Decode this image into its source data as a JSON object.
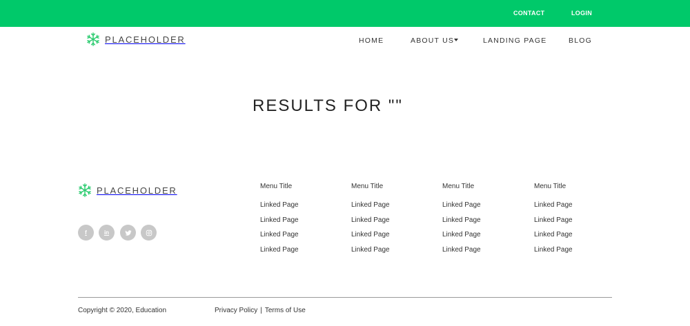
{
  "topbar": {
    "contact_label": "CONTACT",
    "login_label": "LOGIN",
    "background_color": "#00c96a"
  },
  "brand": {
    "name": "PLACEHOLDER",
    "logo_icon": "snowflake-logo-icon",
    "logo_color": "#2ecc71"
  },
  "nav": {
    "items": [
      {
        "label": "HOME"
      },
      {
        "label": "ABOUT US",
        "has_dropdown": true
      },
      {
        "label": "LANDING PAGE"
      },
      {
        "label": "BLOG"
      }
    ]
  },
  "main": {
    "results_heading": "RESULTS FOR \"\""
  },
  "footer": {
    "social": [
      {
        "icon": "facebook-icon",
        "glyph": "f"
      },
      {
        "icon": "linkedin-icon",
        "glyph": "in"
      },
      {
        "icon": "twitter-icon"
      },
      {
        "icon": "instagram-icon"
      }
    ],
    "columns": [
      {
        "title": "Menu Title",
        "links": [
          "Linked Page",
          "Linked Page",
          "Linked Page",
          "Linked Page"
        ]
      },
      {
        "title": "Menu Title",
        "links": [
          "Linked Page",
          "Linked Page",
          "Linked Page",
          "Linked Page"
        ]
      },
      {
        "title": "Menu Title",
        "links": [
          "Linked Page",
          "Linked Page",
          "Linked Page",
          "Linked Page"
        ]
      },
      {
        "title": "Menu Title",
        "links": [
          "Linked Page",
          "Linked Page",
          "Linked Page",
          "Linked Page"
        ]
      }
    ],
    "copyright": "Copyright © 2020, Education",
    "privacy_label": "Privacy Policy",
    "separator": "|",
    "terms_label": "Terms of Use"
  }
}
